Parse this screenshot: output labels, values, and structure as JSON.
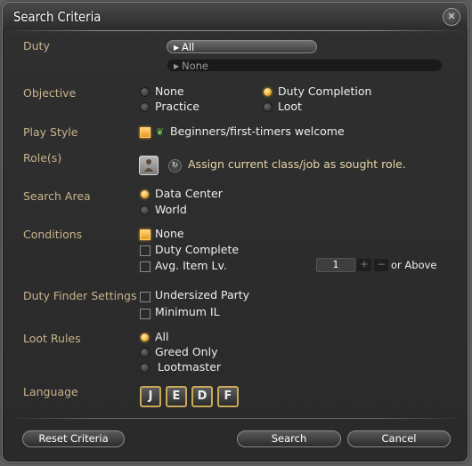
{
  "window": {
    "title": "Search Criteria"
  },
  "duty": {
    "label": "Duty",
    "selected": "All",
    "secondary": "None"
  },
  "objective": {
    "label": "Objective",
    "options": [
      "None",
      "Practice",
      "Duty Completion",
      "Loot"
    ],
    "selected": "Duty Completion"
  },
  "play_style": {
    "label": "Play Style",
    "option": "Beginners/first-timers welcome",
    "checked": true
  },
  "roles": {
    "label": "Role(s)",
    "text": "Assign current class/job as sought role."
  },
  "search_area": {
    "label": "Search Area",
    "options": [
      "Data Center",
      "World"
    ],
    "selected": "Data Center"
  },
  "conditions": {
    "label": "Conditions",
    "options": [
      "None",
      "Duty Complete",
      "Avg. Item Lv."
    ],
    "checked": "None",
    "item_level_value": "1",
    "plus": "+",
    "minus": "−",
    "suffix": "or Above"
  },
  "duty_finder": {
    "label": "Duty Finder Settings",
    "options": [
      "Undersized Party",
      "Minimum IL"
    ]
  },
  "loot_rules": {
    "label": "Loot Rules",
    "options": [
      "All",
      "Greed Only",
      "Lootmaster"
    ],
    "selected": "All"
  },
  "language": {
    "label": "Language",
    "buttons": [
      "J",
      "E",
      "D",
      "F"
    ]
  },
  "footer": {
    "reset": "Reset Criteria",
    "search": "Search",
    "cancel": "Cancel"
  },
  "icons": {
    "close": "close-icon",
    "sprout": "beginner-sprout-icon",
    "role": "job-role-icon",
    "refresh": "refresh-icon"
  },
  "colors": {
    "label": "#c7b48b",
    "accent": "#f0b53c",
    "text": "#eeeeee"
  }
}
